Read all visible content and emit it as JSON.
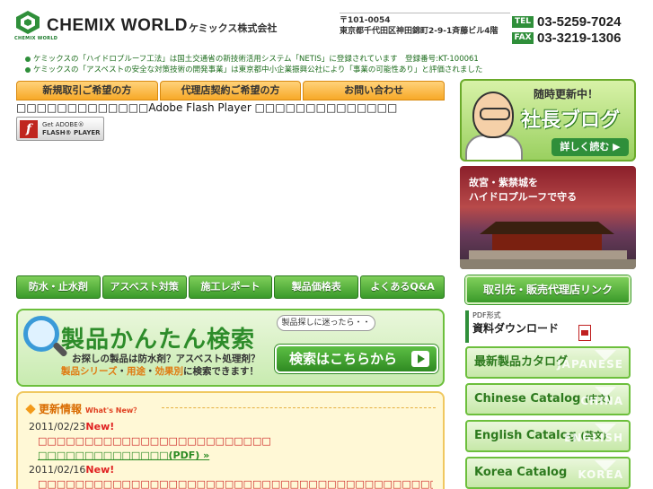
{
  "header": {
    "logo_sub": "CHEMIX WORLD",
    "logo_name": "CHEMIX WORLD",
    "company_jp": "ケミックス株式会社",
    "postal": "〒101-0054",
    "address": "東京都千代田区神田錦町2-9-1斉藤ビル4階",
    "tel_label": "TEL",
    "tel": "03-5259-7024",
    "fax_label": "FAX",
    "fax": "03-3219-1306"
  },
  "notices": [
    "ケミックスの「ハイドロプルーフ工法」は国土交通省の新技術活用システム「NETIS」に登録されています　登録番号:KT-100061",
    "ケミックスの「アスベストの安全な対策技術の開発事業」は東京都中小企業振興公社により「事業の可能性あり」と評価されました"
  ],
  "topnav": [
    "新規取引ご希望の方",
    "代理店契約ご希望の方",
    "お問い合わせ"
  ],
  "flash": {
    "message": "□□□□□□□□□□□□□Adobe Flash Player □□□□□□□□□□□□□□",
    "badge_line1": "Get ADOBE®",
    "badge_line2": "FLASH® PLAYER",
    "badge_icon": "f"
  },
  "catnav": [
    "防水・止水剤",
    "アスベスト対策",
    "施工レポート",
    "製品価格表",
    "よくあるQ&A"
  ],
  "search": {
    "title": "製品かんたん検索",
    "bubble": "製品探しに迷ったら・・",
    "desc1": "お探しの製品は防水剤？アスベスト処理剤？",
    "desc2_hl1": "製品シリーズ",
    "desc2_sep1": "・",
    "desc2_hl2": "用途",
    "desc2_sep2": "・",
    "desc2_hl3": "効果別",
    "desc2_rest": "に検索できます！",
    "button": "検索はこちらから"
  },
  "news": {
    "heading": "更新情報",
    "heading_en": "What's New？",
    "items": [
      {
        "date": "2011/02/23",
        "new": "New!",
        "link": "□□□□□□□□□□□□□□□□□□□□□□□□□",
        "pdf": "□□□□□□□□□□□□□□(PDF) »"
      },
      {
        "date": "2011/02/16",
        "new": "New!",
        "link": "□□□□□□□□□□□□□□□□□□□□□□□□□□□□□□□□□□□□□□□□□□□PDF□□□□□□□□□□"
      }
    ]
  },
  "blog": {
    "top": "随時更新中！",
    "title": "社長ブログ",
    "button": "詳しく読む ▶"
  },
  "palace": {
    "line1": "故宮・紫禁城を",
    "line2": "ハイドロプルーフで守る"
  },
  "agent_link": "取引先・販売代理店リンク",
  "downloads": {
    "small": "PDF形式",
    "title": "資料ダウンロード",
    "items": [
      {
        "label": "最新製品カタログ",
        "tag": "",
        "watermark": "JAPANESE"
      },
      {
        "label": "Chinese Catalog",
        "tag": "(中文)",
        "watermark": "CHINA"
      },
      {
        "label": "English Catalog",
        "tag": "(英文)",
        "watermark": "ENGLISH"
      },
      {
        "label": "Korea Catalog",
        "tag": "",
        "watermark": "KOREA"
      }
    ]
  },
  "colors": {
    "brand_green": "#2f8f3a",
    "accent_orange": "#f7a928",
    "news_red": "#cc2020"
  }
}
